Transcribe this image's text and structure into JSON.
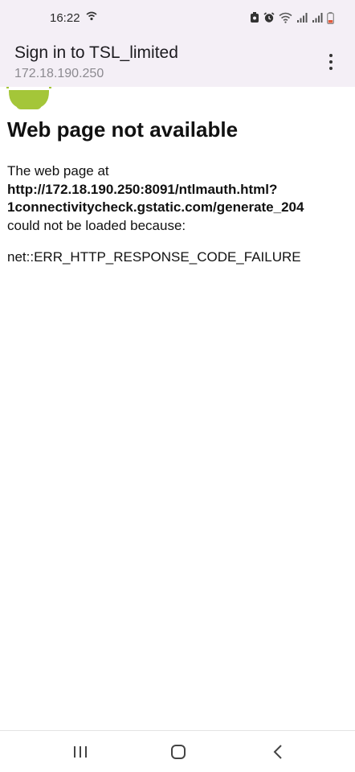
{
  "status_bar": {
    "time": "16:22",
    "icons": [
      "wifi-calling-icon",
      "battery-saver-icon",
      "alarm-icon",
      "wifi-icon",
      "signal-icon",
      "signal-icon",
      "battery-icon"
    ]
  },
  "app_bar": {
    "title": "Sign in to TSL_limited",
    "subtitle": "172.18.190.250",
    "menu_icon": "more-vert-icon"
  },
  "web_page": {
    "heading": "Web page not available",
    "line1": "The web page at",
    "url_line1": "http://172.18.190.250:8091/ntlmauth.html?",
    "url_line2": "1connectivitycheck.gstatic.com/generate_204",
    "line2": "could not be loaded because:",
    "error_code": "net::ERR_HTTP_RESPONSE_CODE_FAILURE"
  },
  "nav_bar": {
    "icons": [
      "recent-apps-icon",
      "home-icon",
      "back-icon"
    ]
  },
  "colors": {
    "app_bar_bg": "#f4eff6",
    "android_green": "#a4c639",
    "text": "#111111",
    "subtitle": "#8c8a90"
  }
}
